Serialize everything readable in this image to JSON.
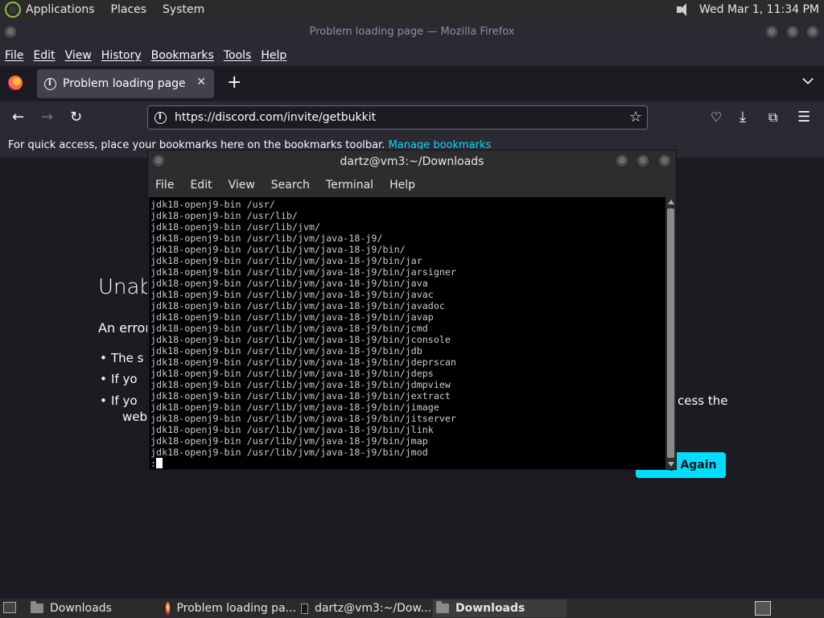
{
  "top_panel": {
    "menus": [
      "Applications",
      "Places",
      "System"
    ],
    "clock": "Wed Mar 1, 11:34 PM"
  },
  "firefox": {
    "window_title": "Problem loading page — Mozilla Firefox",
    "menus": [
      "File",
      "Edit",
      "View",
      "History",
      "Bookmarks",
      "Tools",
      "Help"
    ],
    "tab_title": "Problem loading page",
    "url": "https://discord.com/invite/getbukkit",
    "bookmarks_hint": "For quick access, place your bookmarks here on the bookmarks toolbar.",
    "manage_bookmarks": "Manage bookmarks",
    "error_title_visible": "Unab",
    "error_sub_visible": "An error",
    "bullets_visible": [
      "The s",
      "If yo",
      "If yo"
    ],
    "bullet3_tail": "cess the",
    "bullet3_line2": "web",
    "try_again_visible": "y Again"
  },
  "terminal": {
    "title": "dartz@vm3:~/Downloads",
    "menus": [
      "File",
      "Edit",
      "View",
      "Search",
      "Terminal",
      "Help"
    ],
    "lines": [
      "jdk18-openj9-bin /usr/",
      "jdk18-openj9-bin /usr/lib/",
      "jdk18-openj9-bin /usr/lib/jvm/",
      "jdk18-openj9-bin /usr/lib/jvm/java-18-j9/",
      "jdk18-openj9-bin /usr/lib/jvm/java-18-j9/bin/",
      "jdk18-openj9-bin /usr/lib/jvm/java-18-j9/bin/jar",
      "jdk18-openj9-bin /usr/lib/jvm/java-18-j9/bin/jarsigner",
      "jdk18-openj9-bin /usr/lib/jvm/java-18-j9/bin/java",
      "jdk18-openj9-bin /usr/lib/jvm/java-18-j9/bin/javac",
      "jdk18-openj9-bin /usr/lib/jvm/java-18-j9/bin/javadoc",
      "jdk18-openj9-bin /usr/lib/jvm/java-18-j9/bin/javap",
      "jdk18-openj9-bin /usr/lib/jvm/java-18-j9/bin/jcmd",
      "jdk18-openj9-bin /usr/lib/jvm/java-18-j9/bin/jconsole",
      "jdk18-openj9-bin /usr/lib/jvm/java-18-j9/bin/jdb",
      "jdk18-openj9-bin /usr/lib/jvm/java-18-j9/bin/jdeprscan",
      "jdk18-openj9-bin /usr/lib/jvm/java-18-j9/bin/jdeps",
      "jdk18-openj9-bin /usr/lib/jvm/java-18-j9/bin/jdmpview",
      "jdk18-openj9-bin /usr/lib/jvm/java-18-j9/bin/jextract",
      "jdk18-openj9-bin /usr/lib/jvm/java-18-j9/bin/jimage",
      "jdk18-openj9-bin /usr/lib/jvm/java-18-j9/bin/jitserver",
      "jdk18-openj9-bin /usr/lib/jvm/java-18-j9/bin/jlink",
      "jdk18-openj9-bin /usr/lib/jvm/java-18-j9/bin/jmap",
      "jdk18-openj9-bin /usr/lib/jvm/java-18-j9/bin/jmod"
    ],
    "prompt": ":"
  },
  "taskbar": {
    "items": [
      "Downloads",
      "Problem loading pa...",
      "dartz@vm3:~/Dow...",
      "Downloads"
    ]
  },
  "colors": {
    "accent": "#00ddff",
    "panel": "#2b2b2b",
    "browser_bg": "#1c1b22"
  }
}
